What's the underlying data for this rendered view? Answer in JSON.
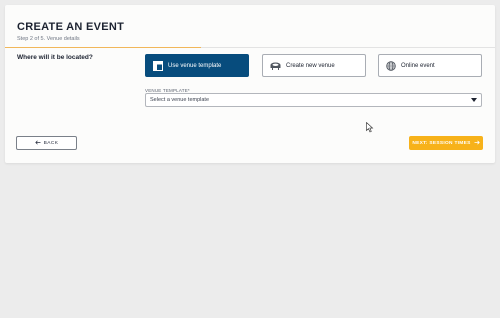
{
  "header": {
    "title": "CREATE AN EVENT",
    "step": "Step 2 of 5. Venue details"
  },
  "progress": {
    "fraction": 0.4
  },
  "location": {
    "question": "Where will it be located?",
    "options": [
      {
        "label": "Use venue template",
        "icon": "template-layout-icon",
        "selected": true
      },
      {
        "label": "Create new venue",
        "icon": "stadium-icon",
        "selected": false
      },
      {
        "label": "Online event",
        "icon": "globe-icon",
        "selected": false
      }
    ]
  },
  "venue_template": {
    "label": "VENUE TEMPLATE*",
    "value": "Select a venue template"
  },
  "footer": {
    "back_label": "BACK",
    "next_label": "NEXT: SESSION TIMES"
  },
  "colors": {
    "selected": "#074c7d",
    "accent": "#f7b21a",
    "progress": "#f1b75a"
  }
}
